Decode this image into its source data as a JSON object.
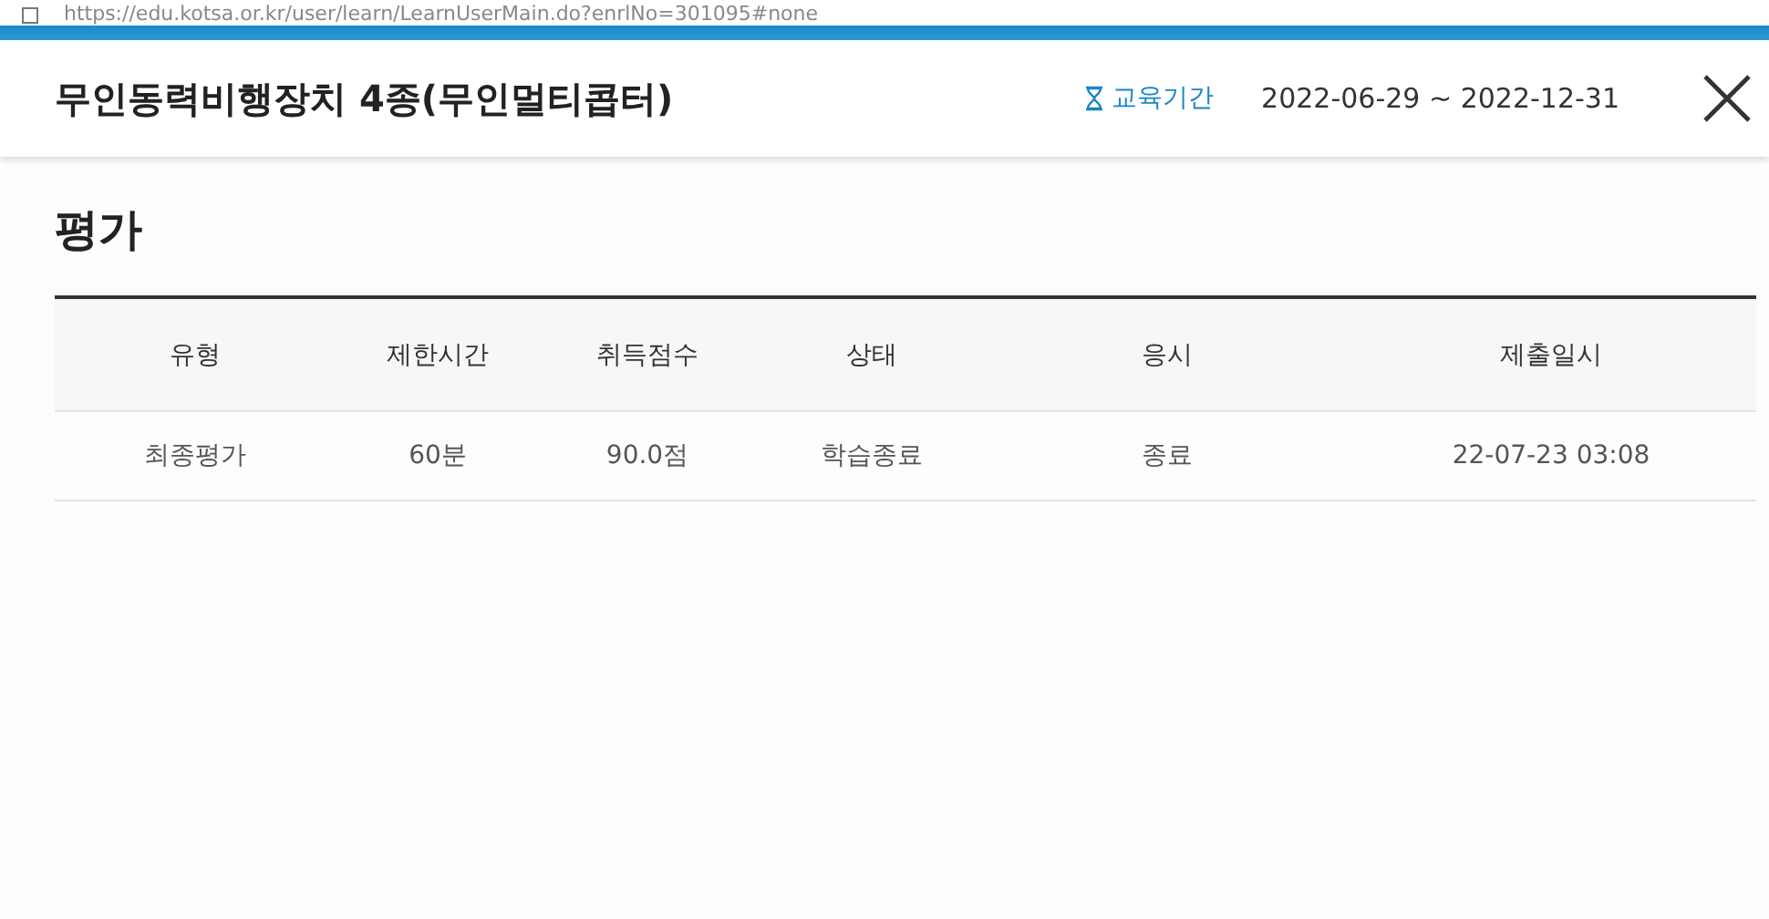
{
  "browser": {
    "url": "https://edu.kotsa.or.kr/user/learn/LearnUserMain.do?enrlNo=301095#none"
  },
  "header": {
    "title": "무인동력비행장치 4종(무인멀티콥터)",
    "period_label": "교육기간",
    "period": "2022-06-29 ~ 2022-12-31"
  },
  "section": {
    "title": "평가"
  },
  "table": {
    "columns": [
      "유형",
      "제한시간",
      "취득점수",
      "상태",
      "응시",
      "제출일시"
    ],
    "rows": [
      [
        "최종평가",
        "60분",
        "90.0점",
        "학습종료",
        "종료",
        "22-07-23 03:08"
      ]
    ]
  }
}
